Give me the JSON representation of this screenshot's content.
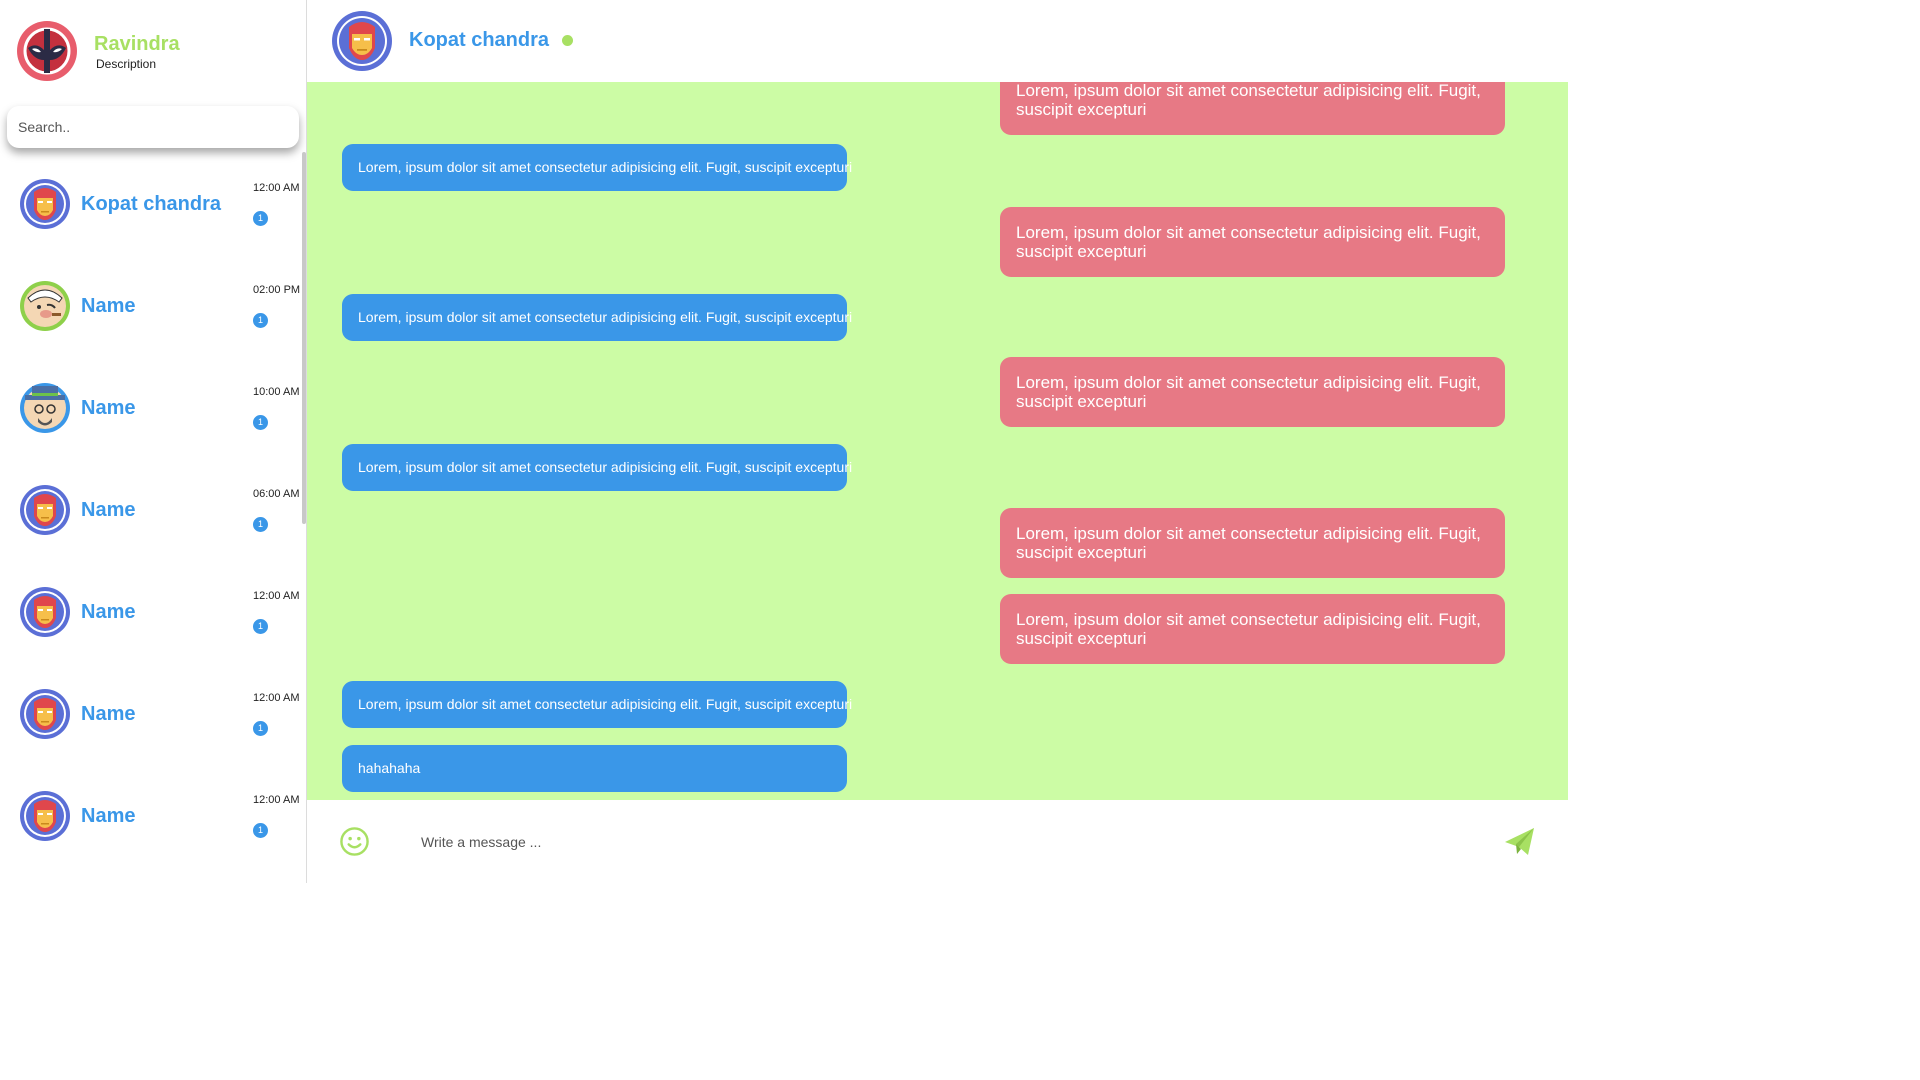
{
  "profile": {
    "name": "Ravindra",
    "description": "Description",
    "avatar_icon": "deadpool-avatar-icon"
  },
  "search": {
    "placeholder": "Search.."
  },
  "contacts": [
    {
      "name": "Kopat chandra",
      "time": "12:00 AM",
      "unread": "1",
      "avatar_icon": "ironman-avatar-icon"
    },
    {
      "name": "Name",
      "time": "02:00 PM",
      "unread": "1",
      "avatar_icon": "popeye-avatar-icon"
    },
    {
      "name": "Name",
      "time": "10:00 AM",
      "unread": "1",
      "avatar_icon": "heisenberg-avatar-icon"
    },
    {
      "name": "Name",
      "time": "06:00 AM",
      "unread": "1",
      "avatar_icon": "ironman-avatar-icon"
    },
    {
      "name": "Name",
      "time": "12:00 AM",
      "unread": "1",
      "avatar_icon": "ironman-avatar-icon"
    },
    {
      "name": "Name",
      "time": "12:00 AM",
      "unread": "1",
      "avatar_icon": "ironman-avatar-icon"
    },
    {
      "name": "Name",
      "time": "12:00 AM",
      "unread": "1",
      "avatar_icon": "ironman-avatar-icon"
    }
  ],
  "chat": {
    "name": "Kopat chandra",
    "status": "online",
    "avatar_icon": "ironman-avatar-icon",
    "messages": [
      {
        "dir": "out",
        "text": "Lorem, ipsum dolor sit amet consectetur adipisicing elit. Fugit, suscipit excepturi"
      },
      {
        "dir": "in",
        "text": "Lorem, ipsum dolor sit amet consectetur adipisicing elit. Fugit, suscipit excepturi"
      },
      {
        "dir": "out",
        "text": "Lorem, ipsum dolor sit amet consectetur adipisicing elit. Fugit, suscipit excepturi"
      },
      {
        "dir": "in",
        "text": "Lorem, ipsum dolor sit amet consectetur adipisicing elit. Fugit, suscipit excepturi"
      },
      {
        "dir": "out",
        "text": "Lorem, ipsum dolor sit amet consectetur adipisicing elit. Fugit, suscipit excepturi"
      },
      {
        "dir": "in",
        "text": "Lorem, ipsum dolor sit amet consectetur adipisicing elit. Fugit, suscipit excepturi"
      },
      {
        "dir": "out",
        "text": "Lorem, ipsum dolor sit amet consectetur adipisicing elit. Fugit, suscipit excepturi"
      },
      {
        "dir": "out",
        "text": "Lorem, ipsum dolor sit amet consectetur adipisicing elit. Fugit, suscipit excepturi"
      },
      {
        "dir": "in",
        "text": "Lorem, ipsum dolor sit amet consectetur adipisicing elit. Fugit, suscipit excepturi"
      },
      {
        "dir": "in",
        "text": "hahahaha"
      }
    ]
  },
  "composer": {
    "placeholder": "Write a message ...",
    "emoji_icon": "smiley-icon",
    "send_icon": "paper-plane-icon"
  },
  "colors": {
    "accent_green": "#a8e063",
    "accent_blue": "#3a97e8",
    "outgoing_bubble": "#e77985",
    "chat_background": "#ccfca5"
  }
}
